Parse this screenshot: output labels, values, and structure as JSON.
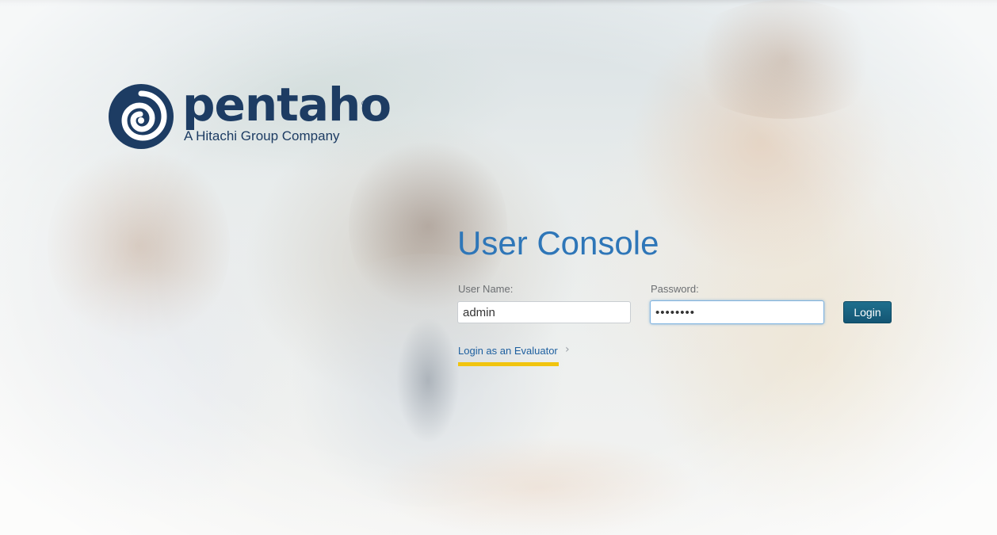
{
  "brand": {
    "name": "pentaho",
    "tagline": "A Hitachi Group Company",
    "registered_mark": "®",
    "color": "#1d3c63"
  },
  "login": {
    "title": "User Console",
    "username_label": "User Name:",
    "username_value": "admin",
    "password_label": "Password:",
    "password_value": "••••••••",
    "submit_label": "Login",
    "evaluator_link": "Login as an Evaluator",
    "evaluator_chevron": "›"
  },
  "colors": {
    "title": "#2e76b8",
    "button": "#145674",
    "accent_underline": "#f1c40f"
  },
  "icons": {
    "logo_mark": "pentaho-swirl-icon",
    "link_arrow": "chevron-right-icon"
  }
}
